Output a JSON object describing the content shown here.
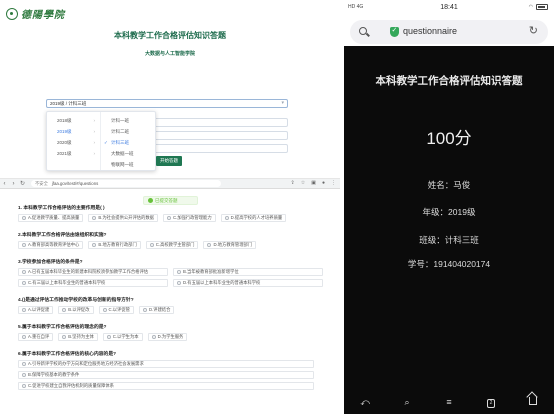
{
  "top_form": {
    "logo_text": "德陽學院",
    "title": "本科教学工作合格评估知识答题",
    "subtitle": "大数据与人工智能学院",
    "class_select_value": "2019级 / 计科三班",
    "dropdown": {
      "years": [
        {
          "label": "2018级",
          "active": false
        },
        {
          "label": "2019级",
          "active": true
        },
        {
          "label": "2020级",
          "active": false
        },
        {
          "label": "2021级",
          "active": false
        }
      ],
      "classes": [
        {
          "label": "计科一班",
          "active": false
        },
        {
          "label": "计科二班",
          "active": false
        },
        {
          "label": "计科三班",
          "active": true
        },
        {
          "label": "大数据一班",
          "active": false
        },
        {
          "label": "物联网一班",
          "active": false
        }
      ]
    },
    "submit_label": "开始答题"
  },
  "browser": {
    "warning": "不安全",
    "url": "jfaa.gov/test/#/questions",
    "toast": "已提交答题"
  },
  "questions": [
    {
      "title": "1. 本科教学工作合格评估的主要作用是( )",
      "options": [
        "A.促进教学质量、提高质量",
        "B.为社会提供公开评估的数据",
        "C.加强行政管理能力",
        "D.提高学校的人才培养质量"
      ]
    },
    {
      "title": "2.本科教学工作合格评估由谁组织和实施?",
      "options": [
        "A.教育部高等教育评估中心",
        "B.地方教育行政部门",
        "C.高校教学主管部门",
        "D.地方教育管理部门"
      ]
    },
    {
      "title": "3.学校参加合格评估的条件是?",
      "options": [
        "A.已有五届本科毕业生的新建本科院校须参加教学工作合格评估",
        "B.当年被教育部批准新增学位",
        "C.有三届以上本科毕业生的普通本科学校",
        "D.有五届以上本科毕业生的普通本科学校"
      ]
    },
    {
      "title": "4.()是通过评估工作推动学校的改革与创新的指导方针?",
      "options": [
        "A.以评促建",
        "B.以评促改",
        "C.以评促管",
        "D.评建结合"
      ]
    },
    {
      "title": "5.属于本科教学工作合格评估的理念的是?",
      "options": [
        "A.重在自评",
        "B.坚持为主体",
        "C.以学生为本",
        "D.为学生服务"
      ]
    },
    {
      "title": "6.属于本科教学工作合格评估的核心内容的是?",
      "options": [
        "A.引导新评学校的办学方向和定位服务地方经济社会发展需求",
        "B.保障学校基本的教学条件",
        "C.促进学校建立自我评估机制的质量保障体系"
      ]
    }
  ],
  "phone": {
    "status_left": "HD 4G",
    "time": "18:41",
    "url": "questionnaire",
    "result_title": "本科教学工作合格评估知识答题",
    "score": "100分",
    "name": "姓名：马俊",
    "grade": "年级：2019级",
    "class": "班级：计科三班",
    "student_id": "学号：191404020174"
  }
}
